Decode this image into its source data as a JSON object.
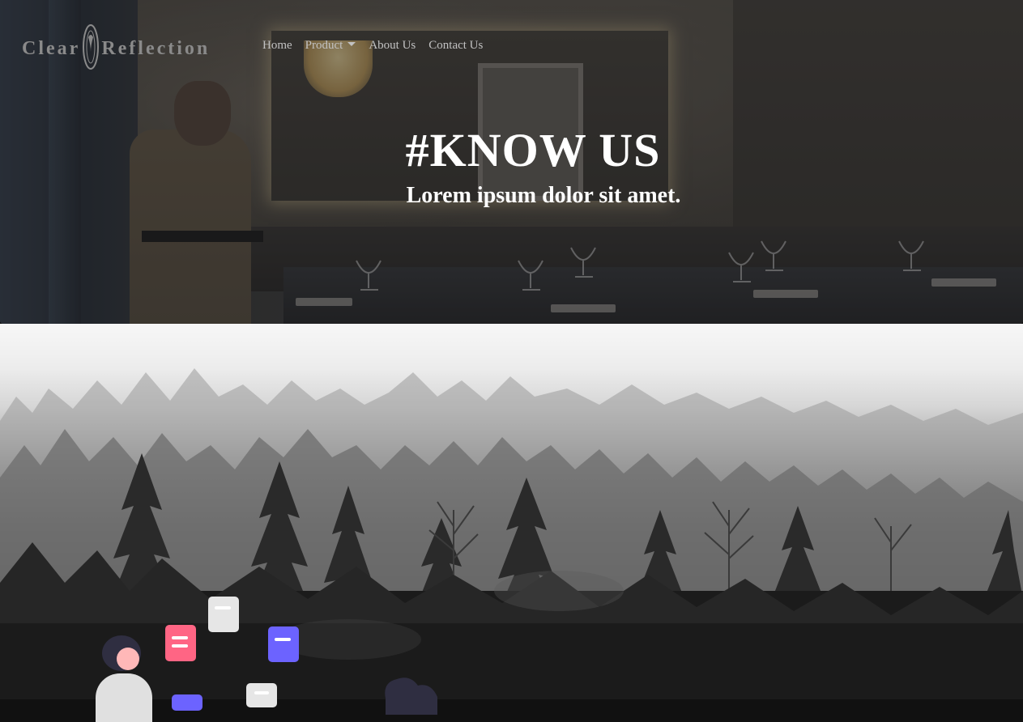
{
  "brand": {
    "name_left": "Clear",
    "name_right": "Reflection",
    "logo": "mirror-icon"
  },
  "nav": {
    "home": "Home",
    "product": "Product",
    "about": "About Us",
    "contact": "Contact Us"
  },
  "hero": {
    "title": "#KNOW US",
    "subtitle": "Lorem ipsum dolor sit amet."
  },
  "colors": {
    "nav_text": "#c2c2c2",
    "hero_text": "#ffffff",
    "accent_pink": "#ff6584",
    "accent_purple": "#6c63ff",
    "dark_figure": "#2f2e41"
  }
}
